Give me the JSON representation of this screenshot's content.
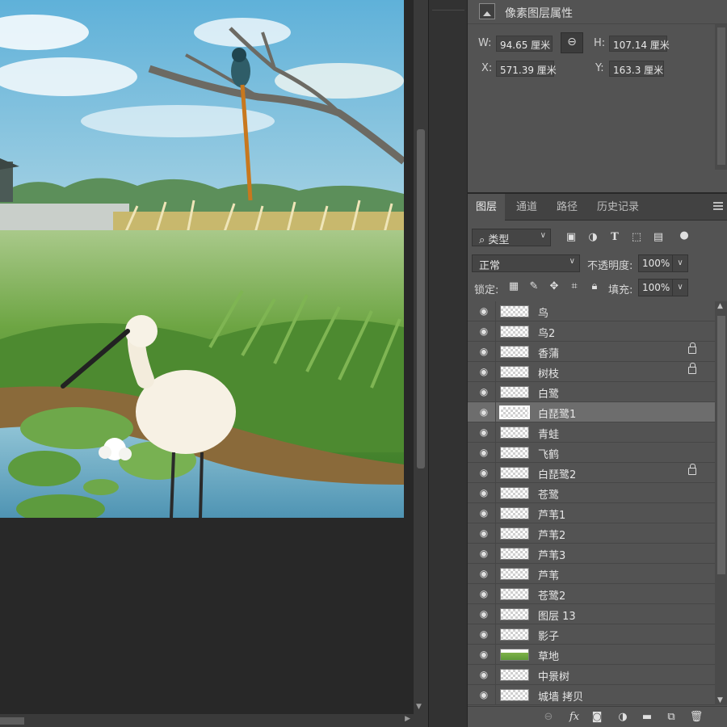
{
  "properties": {
    "title": "像素图层属性",
    "w_label": "W:",
    "w_value": "94.65 厘米",
    "h_label": "H:",
    "h_value": "107.14 厘米",
    "x_label": "X:",
    "x_value": "571.39 厘米",
    "y_label": "Y:",
    "y_value": "163.3 厘米",
    "link_icon": "link-icon"
  },
  "tabs": [
    {
      "label": "图层",
      "active": true
    },
    {
      "label": "通道",
      "active": false
    },
    {
      "label": "路径",
      "active": false
    },
    {
      "label": "历史记录",
      "active": false
    }
  ],
  "filter": {
    "kind_label": "类型"
  },
  "blend": {
    "mode": "正常",
    "opacity_label": "不透明度:",
    "opacity_value": "100%",
    "lock_label": "锁定:",
    "fill_label": "填充:",
    "fill_value": "100%"
  },
  "layers": [
    {
      "name": "鸟",
      "locked": false,
      "selected": false,
      "thumb": "checker"
    },
    {
      "name": "鸟2",
      "locked": false,
      "selected": false,
      "thumb": "checker"
    },
    {
      "name": "香蒲",
      "locked": true,
      "selected": false,
      "thumb": "checker"
    },
    {
      "name": "树枝",
      "locked": true,
      "selected": false,
      "thumb": "checker"
    },
    {
      "name": "白鹭",
      "locked": false,
      "selected": false,
      "thumb": "checker"
    },
    {
      "name": "白琵鹭1",
      "locked": false,
      "selected": true,
      "thumb": "checker"
    },
    {
      "name": "青蛙",
      "locked": false,
      "selected": false,
      "thumb": "checker"
    },
    {
      "name": "飞鹤",
      "locked": false,
      "selected": false,
      "thumb": "checker"
    },
    {
      "name": "白琵鹭2",
      "locked": true,
      "selected": false,
      "thumb": "checker"
    },
    {
      "name": "苍鹭",
      "locked": false,
      "selected": false,
      "thumb": "checker"
    },
    {
      "name": "芦苇1",
      "locked": false,
      "selected": false,
      "thumb": "checker"
    },
    {
      "name": "芦苇2",
      "locked": false,
      "selected": false,
      "thumb": "checker"
    },
    {
      "name": "芦苇3",
      "locked": false,
      "selected": false,
      "thumb": "checker"
    },
    {
      "name": "芦苇",
      "locked": false,
      "selected": false,
      "thumb": "checker"
    },
    {
      "name": "苍鹭2",
      "locked": false,
      "selected": false,
      "thumb": "checker"
    },
    {
      "name": "图层 13",
      "locked": false,
      "selected": false,
      "thumb": "checker"
    },
    {
      "name": "影子",
      "locked": false,
      "selected": false,
      "thumb": "checker"
    },
    {
      "name": "草地",
      "locked": false,
      "selected": false,
      "thumb": "green"
    },
    {
      "name": "中景树",
      "locked": false,
      "selected": false,
      "thumb": "checker"
    },
    {
      "name": "城墙 拷贝",
      "locked": false,
      "selected": false,
      "thumb": "checker"
    }
  ],
  "colors": {
    "panel_bg": "#535353",
    "selected_row": "#6d6d6d",
    "canvas_bg": "#282828"
  }
}
